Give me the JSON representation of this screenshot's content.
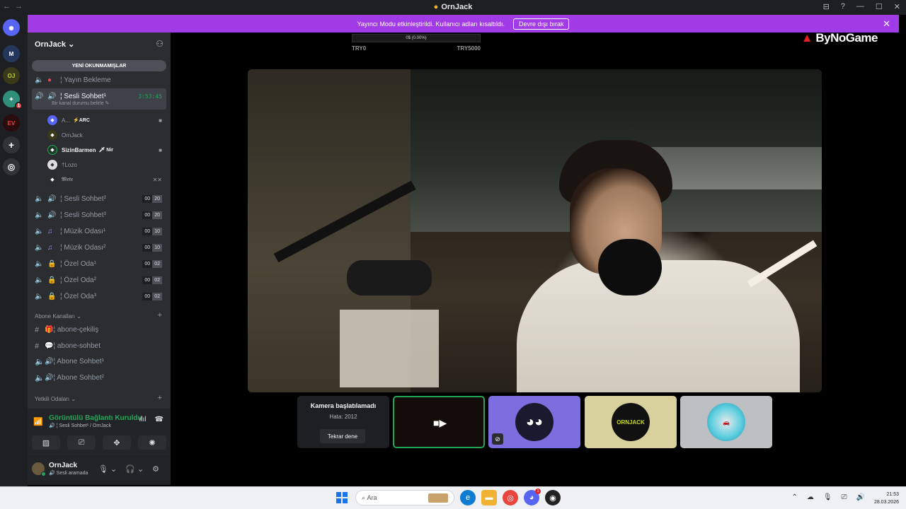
{
  "window": {
    "title": "OrnJack",
    "controls": [
      "⊟",
      "?",
      "—",
      "☐",
      "✕"
    ]
  },
  "banner": {
    "text": "Yayıncı Modu etkinleştirildi. Kullanıcı adları kısaltıldı.",
    "button": "Devre dışı bırak"
  },
  "rail": {
    "badge": "1"
  },
  "sidebar": {
    "guild": "OrnJack",
    "unread_pill": "YENİ OKUNMAMIŞLAR",
    "channels": [
      {
        "name": "¦ Yayın Bekleme"
      },
      {
        "name": "¦ Sesli Sohbet¹",
        "timer": "3:53:45",
        "status": "Bir kanal durumu belirle ✎"
      }
    ],
    "members": [
      {
        "name": "A...",
        "tag": "⚡ARC"
      },
      {
        "name": "OrnJack"
      },
      {
        "name": "SizinBarmen",
        "tag": "🗡 Nir"
      },
      {
        "name": "†Lozo"
      },
      {
        "name": "𝕸𝖊𝖙𝖊"
      }
    ],
    "voice_channels": [
      {
        "name": "¦ Sesli Sohbet²",
        "a": "00",
        "b": "20"
      },
      {
        "name": "¦ Sesli Sohbet³",
        "a": "00",
        "b": "20"
      },
      {
        "name": "¦ Müzik Odası¹",
        "a": "00",
        "b": "10"
      },
      {
        "name": "¦ Müzik Odası²",
        "a": "00",
        "b": "10"
      },
      {
        "name": "¦ Özel Oda¹",
        "a": "00",
        "b": "02"
      },
      {
        "name": "¦ Özel Oda²",
        "a": "00",
        "b": "02"
      },
      {
        "name": "¦ Özel Oda³",
        "a": "00",
        "b": "02"
      }
    ],
    "category_subs": "Abone Kanalları ⌄",
    "sub_channels": [
      {
        "name": "¦ abone-çekiliş"
      },
      {
        "name": "¦ abone-sohbet"
      },
      {
        "name": "¦ Abone Sohbet¹"
      },
      {
        "name": "¦ Abone Sohbet²"
      }
    ],
    "category_staff": "Yetkili Odaları ⌄",
    "voice_panel": {
      "title": "Görüntülü Bağlantı Kuruldu",
      "sub": "🔊 ¦ Sesli Sohbet¹ / OrnJack"
    },
    "user": {
      "name": "OrnJack",
      "status": "🔊 Sesli aramada"
    }
  },
  "stage": {
    "goal_bar_text": "0$ (0.00%)",
    "goal_min": "TRY0",
    "goal_max": "TRY5000",
    "brand": "ByNoGame"
  },
  "tiles": {
    "error_title": "Kamera başlatılamadı",
    "error_code": "Hata: 2012",
    "retry": "Tekrar dene",
    "logo_text": "ORNJACK"
  },
  "taskbar": {
    "search_placeholder": "Ara",
    "discord_badge": "1",
    "time": "21:53",
    "date": "28.03.2026"
  }
}
